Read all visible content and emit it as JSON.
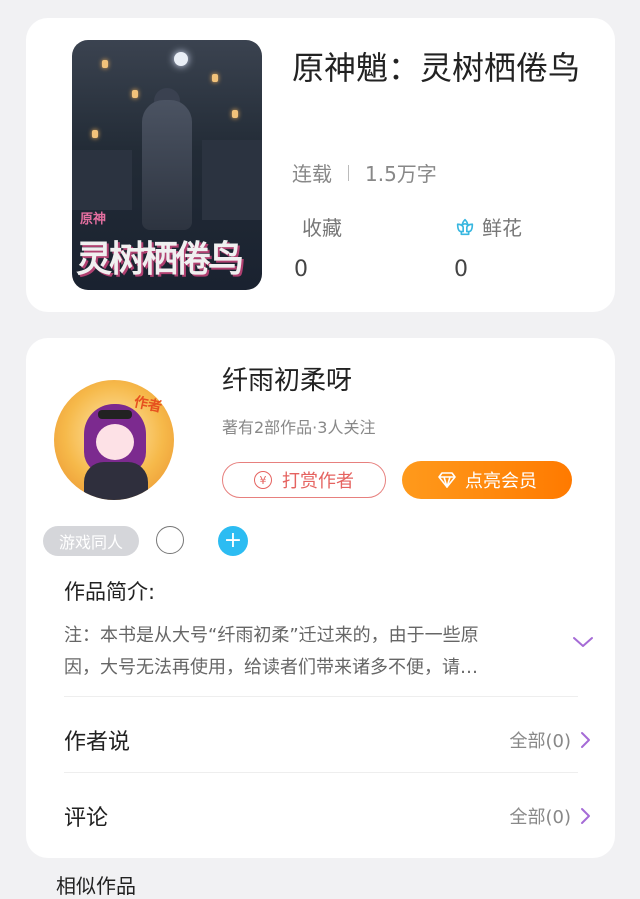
{
  "book": {
    "title": "原神魈：灵树栖倦鸟",
    "cover": {
      "small_text": "原神",
      "title_text": "灵树栖倦鸟"
    },
    "status": "连载",
    "word_count": "1.5万字",
    "stats": [
      {
        "label": "收藏",
        "value": "0",
        "icon": null
      },
      {
        "label": "鲜花",
        "value": "0",
        "icon": "flower-icon"
      }
    ]
  },
  "author": {
    "name": "纤雨初柔呀",
    "meta": "著有2部作品·3人关注",
    "avatar_tag": "作者",
    "tip_button": "打赏作者",
    "vip_button": "点亮会员",
    "tags": [
      "游戏同人"
    ]
  },
  "intro": {
    "title": "作品简介:",
    "lines": [
      "注：本书是从大号“纤雨初柔”迁过来的，由于一些原",
      "因，大号无法再使用，给读者们带来诸多不便，请…"
    ]
  },
  "rows": [
    {
      "title": "作者说",
      "all_label": "全部(0)"
    },
    {
      "title": "评论",
      "all_label": "全部(0)"
    }
  ],
  "similar_title": "相似作品",
  "colors": {
    "accent_orange": "#ff8a10",
    "tip_red": "#e56360",
    "plus_blue": "#2cbcf2",
    "flower_teal": "#39b7e0",
    "chevron_purple": "#a56bd6"
  }
}
